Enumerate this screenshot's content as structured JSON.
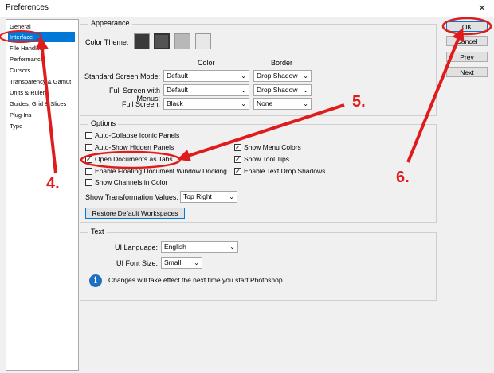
{
  "window": {
    "title": "Preferences",
    "close_glyph": "✕"
  },
  "sidebar": {
    "items": [
      {
        "label": "General",
        "selected": false
      },
      {
        "label": "Interface",
        "selected": true
      },
      {
        "label": "File Handling",
        "selected": false
      },
      {
        "label": "Performance",
        "selected": false
      },
      {
        "label": "Cursors",
        "selected": false
      },
      {
        "label": "Transparency & Gamut",
        "selected": false
      },
      {
        "label": "Units & Rulers",
        "selected": false
      },
      {
        "label": "Guides, Grid & Slices",
        "selected": false
      },
      {
        "label": "Plug-Ins",
        "selected": false
      },
      {
        "label": "Type",
        "selected": false
      }
    ]
  },
  "appearance": {
    "group_label": "Appearance",
    "color_theme_label": "Color Theme:",
    "theme_swatches": [
      "#3a3a3a",
      "#535353",
      "#b8b8b8",
      "#e8e8e8"
    ],
    "col_color": "Color",
    "col_border": "Border",
    "rows": [
      {
        "label": "Standard Screen Mode:",
        "color": "Default",
        "border": "Drop Shadow"
      },
      {
        "label": "Full Screen with Menus:",
        "color": "Default",
        "border": "Drop Shadow"
      },
      {
        "label": "Full Screen:",
        "color": "Black",
        "border": "None"
      }
    ]
  },
  "options": {
    "group_label": "Options",
    "left_checks": [
      {
        "label": "Auto-Collapse Iconic Panels",
        "checked": false
      },
      {
        "label": "Auto-Show Hidden Panels",
        "checked": false
      },
      {
        "label": "Open Documents as Tabs",
        "checked": true
      },
      {
        "label": "Enable Floating Document Window Docking",
        "checked": false
      },
      {
        "label": "Show Channels in Color",
        "checked": false
      }
    ],
    "right_checks": [
      {
        "label": "Show Menu Colors",
        "checked": true
      },
      {
        "label": "Show Tool Tips",
        "checked": true
      },
      {
        "label": "Enable Text Drop Shadows",
        "checked": true
      }
    ],
    "transform_label": "Show Transformation Values:",
    "transform_value": "Top Right",
    "restore_label": "Restore Default Workspaces"
  },
  "text": {
    "group_label": "Text",
    "ui_language_label": "UI Language:",
    "ui_language_value": "English",
    "ui_font_size_label": "UI Font Size:",
    "ui_font_size_value": "Small",
    "info_message": "Changes will take effect the next time you start Photoshop.",
    "info_glyph": "i"
  },
  "buttons": {
    "ok": "OK",
    "cancel": "Cancel",
    "prev": "Prev",
    "next": "Next"
  },
  "annotations": {
    "step4": "4.",
    "step5": "5.",
    "step6": "6.",
    "color": "#e01b1b"
  },
  "checkmark": "✓",
  "dropdown_arrow": "⌄"
}
